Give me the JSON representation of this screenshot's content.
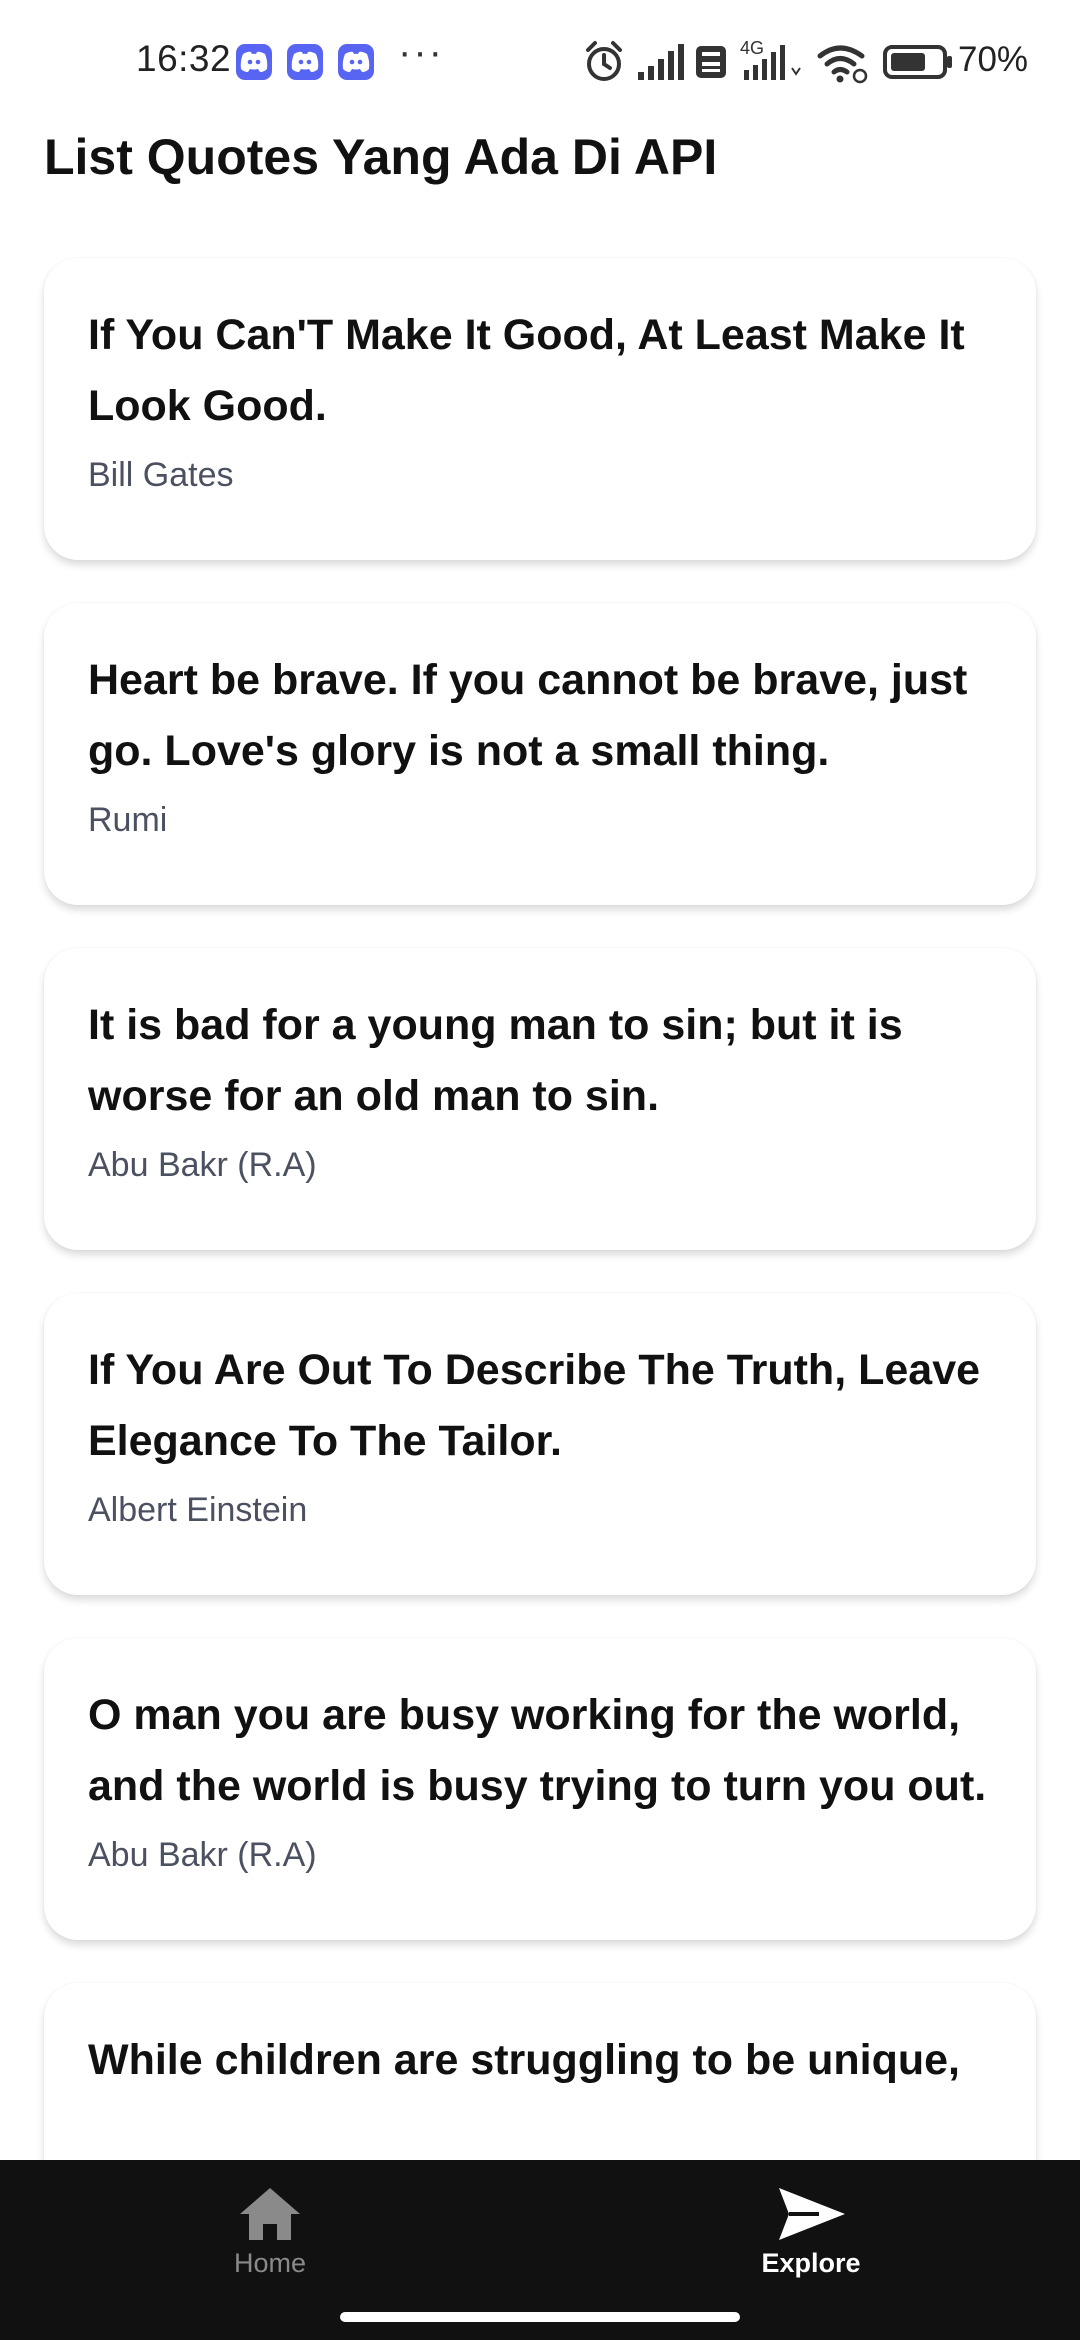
{
  "status_bar": {
    "time": "16:32",
    "notification_icons": [
      "discord-icon",
      "discord-icon",
      "discord-icon"
    ],
    "more": "···",
    "network_badge": "4G",
    "battery_percent": "70%",
    "battery_level": 0.7
  },
  "header": {
    "title": "List Quotes Yang Ada Di API"
  },
  "quotes": [
    {
      "text": "If You Can'T Make It Good, At Least Make It Look Good.",
      "author": "Bill Gates"
    },
    {
      "text": "Heart be brave. If you cannot be brave, just go. Love's glory is not a small thing.",
      "author": "Rumi"
    },
    {
      "text": "It is bad for a young man to sin; but it is worse for an old man to sin.",
      "author": "Abu Bakr (R.A)"
    },
    {
      "text": "If You Are Out To Describe The Truth, Leave Elegance To The Tailor.",
      "author": "Albert Einstein"
    },
    {
      "text": "O man you are busy working for the world, and the world is busy trying to turn you out.",
      "author": "Abu Bakr (R.A)"
    },
    {
      "text": "While children are struggling to be unique,",
      "author": ""
    }
  ],
  "bottom_nav": {
    "items": [
      {
        "label": "Home",
        "icon": "home-icon",
        "active": false
      },
      {
        "label": "Explore",
        "icon": "send-icon",
        "active": true
      }
    ]
  },
  "colors": {
    "nav_background": "#111111",
    "inactive": "#8a8a8a",
    "active": "#ffffff",
    "discord": "#5865F2"
  }
}
